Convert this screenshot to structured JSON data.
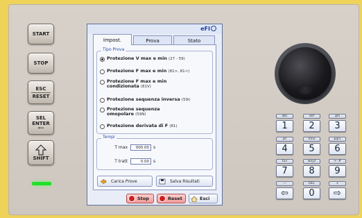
{
  "side_buttons": [
    {
      "label": "START"
    },
    {
      "label": "STOP"
    },
    {
      "label_top": "ESC",
      "label_bottom": "RESET"
    },
    {
      "label_top": "SEL",
      "label_mid": "ENTER"
    },
    {
      "label": "SHIFT"
    }
  ],
  "screen": {
    "logo": "eFI",
    "tabs": [
      "Impost.",
      "Prova",
      "Stato"
    ],
    "active_tab": "Impost.",
    "tipo_prova": {
      "legend": "Tipo Prova",
      "options": [
        {
          "text": "Protezione V max e min",
          "code": "(27 - 59)",
          "selected": true
        },
        {
          "text": "Protezione F max e min",
          "code": "(81>, 81<)",
          "selected": false
        },
        {
          "text": "Protezione F max e min condizionata",
          "code": "(81V)",
          "selected": false
        },
        {
          "text": "Protezione sequenza inversa",
          "code": "(59i)",
          "selected": false
        },
        {
          "text": "Protezione sequenza omopolare",
          "code": "(59N)",
          "selected": false
        },
        {
          "text": "Protezione derivata di F",
          "code": "(81)",
          "selected": false
        }
      ]
    },
    "tempi": {
      "legend": "Tempi",
      "t_max_label": "T max",
      "t_max_value": "000.00",
      "t_trat_label": "T tratt",
      "t_trat_value": "0.00",
      "unit": "s"
    },
    "load_button": "Carica Prove",
    "save_button": "Salva Risultati",
    "stop_button": "Stop",
    "reset_button": "Reset",
    "exit_button": "Esci"
  },
  "keypad": {
    "rows": [
      [
        {
          "sub": "abc",
          "main": "1"
        },
        {
          "sub": "def",
          "main": "2"
        },
        {
          "sub": "ghi",
          "main": "3"
        }
      ],
      [
        {
          "sub": "jkl",
          "main": "4"
        },
        {
          "sub": "mno",
          "main": "5"
        },
        {
          "sub": "pqrs",
          "main": "6"
        }
      ],
      [
        {
          "sub": "tuv",
          "main": "7"
        },
        {
          "sub": "wxyz",
          "main": "8"
        },
        {
          "sub": "+-.#",
          "main": "9"
        }
      ],
      [
        {
          "sub": "—",
          "main": "⇦"
        },
        {
          "sub": "DEL",
          "main": "0"
        },
        {
          "sub": "+",
          "main": "⇨"
        }
      ]
    ]
  },
  "colors": {
    "frame": "#efd25a",
    "panel": "#cdc7bf",
    "led": "#20e02a",
    "screen_accent": "#1a3d9c"
  }
}
